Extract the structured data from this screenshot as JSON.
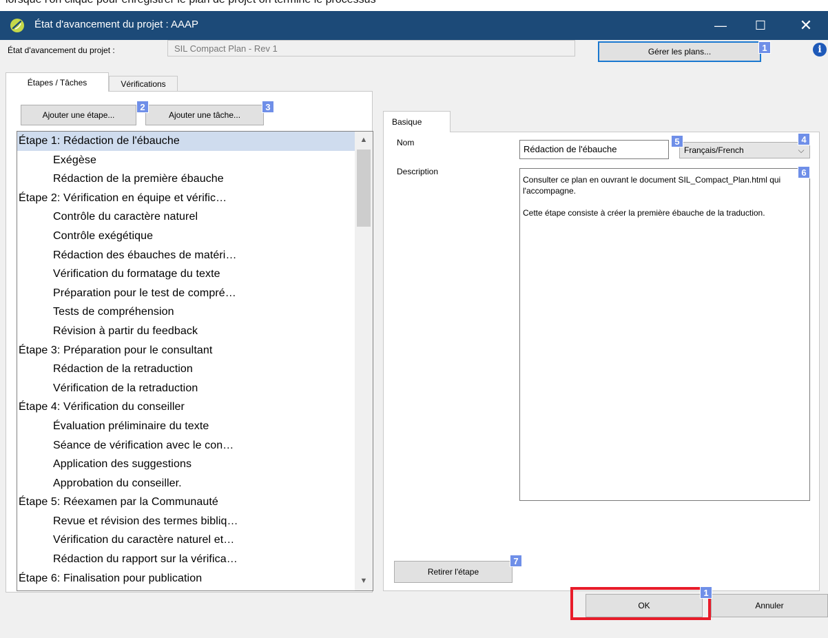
{
  "top_cut_text": "lorsque l'on clique pour enregistrer le plan de projet on termine le processus",
  "window": {
    "title": "État d'avancement du projet : AAAP",
    "minimize_glyph": "—",
    "maximize_glyph": "☐",
    "close_glyph": "✕"
  },
  "progress": {
    "label": "État d'avancement du projet :",
    "value": "SIL Compact Plan - Rev 1",
    "manage_label": "Gérer les plans..."
  },
  "tabs": {
    "steps": "Étapes / Tâches",
    "verifications": "Vérifications"
  },
  "buttons": {
    "add_step": "Ajouter une étape...",
    "add_task": "Ajouter une tâche...",
    "remove_step": "Retirer l'étape",
    "ok": "OK",
    "cancel": "Annuler"
  },
  "list": [
    {
      "text": "Étape 1: Rédaction de l'ébauche",
      "kind": "step",
      "selected": true
    },
    {
      "text": "Exégèse",
      "kind": "task"
    },
    {
      "text": "Rédaction de la première ébauche",
      "kind": "task"
    },
    {
      "text": "Étape 2: Vérification en équipe et vérific…",
      "kind": "step"
    },
    {
      "text": "Contrôle du caractère naturel",
      "kind": "task"
    },
    {
      "text": "Contrôle exégétique",
      "kind": "task"
    },
    {
      "text": "Rédaction des ébauches de matéri…",
      "kind": "task"
    },
    {
      "text": "Vérification du formatage du texte",
      "kind": "task"
    },
    {
      "text": "Préparation pour le test de compré…",
      "kind": "task"
    },
    {
      "text": "Tests de compréhension",
      "kind": "task"
    },
    {
      "text": "Révision à partir du feedback",
      "kind": "task"
    },
    {
      "text": "Étape 3: Préparation pour le consultant",
      "kind": "step"
    },
    {
      "text": "Rédaction de la retraduction",
      "kind": "task"
    },
    {
      "text": "Vérification de la retraduction",
      "kind": "task"
    },
    {
      "text": "Étape 4: Vérification du conseiller",
      "kind": "step"
    },
    {
      "text": "Évaluation préliminaire du texte",
      "kind": "task"
    },
    {
      "text": "Séance de vérification avec le con…",
      "kind": "task"
    },
    {
      "text": "Application des suggestions",
      "kind": "task"
    },
    {
      "text": "Approbation du conseiller.",
      "kind": "task"
    },
    {
      "text": "Étape 5: Réexamen par la Communauté",
      "kind": "step"
    },
    {
      "text": "Revue et révision des termes bibliq…",
      "kind": "task"
    },
    {
      "text": "Vérification du caractère naturel et…",
      "kind": "task"
    },
    {
      "text": "Rédaction du rapport sur la vérifica…",
      "kind": "task"
    },
    {
      "text": "Étape 6: Finalisation pour publication",
      "kind": "step"
    }
  ],
  "scroll": {
    "up_glyph": "▲",
    "down_glyph": "▼"
  },
  "basic": {
    "tab_label": "Basique",
    "name_label": "Nom",
    "name_value": "Rédaction de l'ébauche",
    "language_value": "Français/French",
    "language_chevron": "⌵",
    "description_label": "Description",
    "description_p1": "Consulter ce plan en ouvrant le document SIL_Compact_Plan.html qui l'accompagne.",
    "description_p2": "Cette étape consiste à créer la première ébauche de la traduction."
  },
  "badges": {
    "b1": "1",
    "b2": "2",
    "b3": "3",
    "b4": "4",
    "b5": "5",
    "b6": "6",
    "b7": "7",
    "b1_bottom": "1"
  },
  "info_glyph": "i",
  "colors": {
    "titlebar": "#1c4a78",
    "badge": "#6f8fe8",
    "highlight": "#e81c2a",
    "selection": "#cfdcee",
    "focus_border": "#1a78d0",
    "info_icon": "#1e59b8"
  }
}
